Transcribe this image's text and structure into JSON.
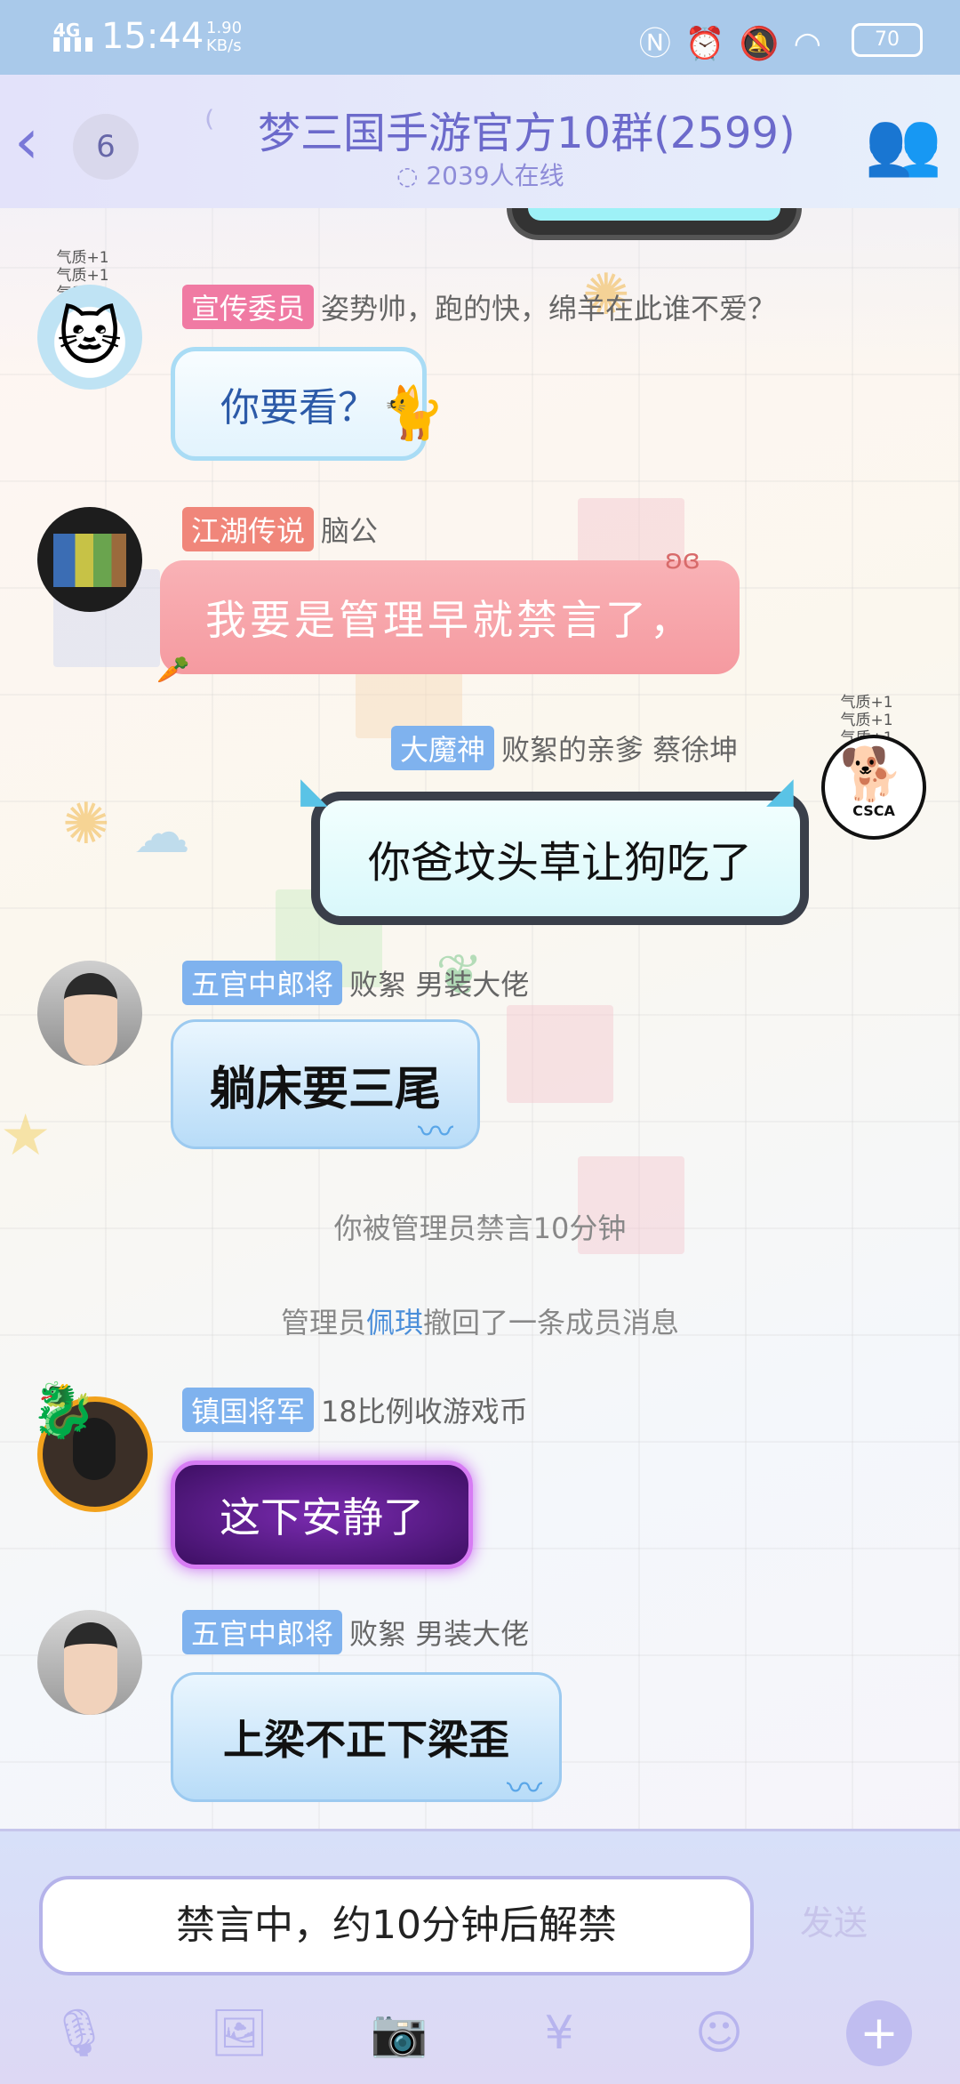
{
  "status_bar": {
    "network": "4G",
    "time": "15:44",
    "speed_value": "1.90",
    "speed_unit": "KB/s",
    "battery": "70",
    "icons": [
      "nfc-icon",
      "alarm-icon",
      "mute-icon",
      "wifi-icon"
    ]
  },
  "header": {
    "unread_count": "6",
    "group_title": "梦三国手游官方10群(2599)",
    "online_text": "2039人在线"
  },
  "messages": [
    {
      "flair": [
        "气质+1",
        "气质+1",
        "气质+1"
      ],
      "tag": "宣传委员",
      "tag_color": "#f07aa3",
      "name": "姿势帅，跑的快，绵羊在此谁不爱？",
      "text": "你要看？"
    },
    {
      "tag": "江湖传说",
      "tag_color": "#f0867a",
      "name": "脑公",
      "text": "我要是管理早就禁言了，"
    },
    {
      "flair": [
        "气质+1",
        "气质+1",
        "气质+1"
      ],
      "avatar_text": "CSCA",
      "tag": "大魔神",
      "tag_color": "#7fb2ee",
      "name": "败絮的亲爹 蔡徐坤",
      "text": "你爸坟头草让狗吃了"
    },
    {
      "tag": "五官中郎将",
      "tag_color": "#7fb2ee",
      "name": "败絮 男装大佬",
      "text": "躺床要三尾"
    },
    {
      "tag": "镇国将军",
      "tag_color": "#7fb2ee",
      "name": "18比例收游戏币",
      "text": "这下安静了"
    },
    {
      "tag": "五官中郎将",
      "tag_color": "#7fb2ee",
      "name": "败絮 男装大佬",
      "text": "上梁不正下梁歪"
    }
  ],
  "system": {
    "muted_notice": "你被管理员禁言10分钟",
    "recall_prefix": "管理员",
    "recall_admin": "佩琪",
    "recall_suffix": "撤回了一条成员消息"
  },
  "input": {
    "placeholder": "禁言中，约10分钟后解禁",
    "send_label": "发送",
    "tools": [
      "voice-icon",
      "image-icon",
      "camera-icon",
      "red-packet-icon",
      "emoji-icon",
      "plus-icon"
    ]
  },
  "colors": {
    "status_bar": "#a9c9ea",
    "header_text": "#6c6acb",
    "blue_bubble": "#cfe7fb",
    "pink_bubble": "#f8a9ad",
    "purple_bubble": "#5a1c86"
  }
}
